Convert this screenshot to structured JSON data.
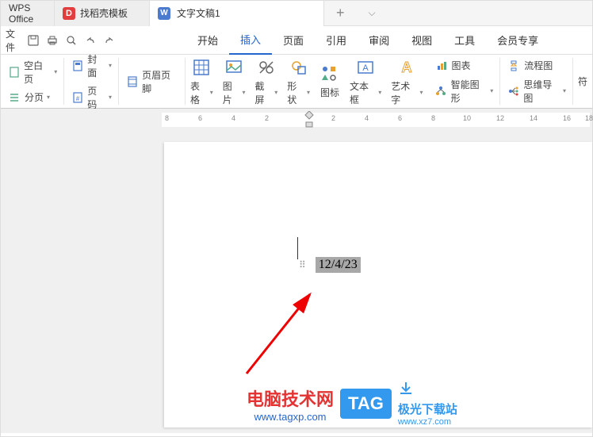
{
  "title_bar": {
    "app_name": "WPS Office",
    "template_tab": "找稻壳模板",
    "doc_tab": "文字文稿1",
    "new_tab": "+"
  },
  "menu": {
    "file": "文件",
    "start": "开始",
    "insert": "插入",
    "page": "页面",
    "reference": "引用",
    "review": "审阅",
    "view": "视图",
    "tools": "工具",
    "member": "会员专享"
  },
  "ribbon": {
    "cover": "封面",
    "page_num": "页码",
    "blank_page": "分页",
    "header_footer": "页眉页脚",
    "table": "表格",
    "picture": "图片",
    "screenshot": "截屏",
    "shape": "形状",
    "icon": "图标",
    "textbox": "文本框",
    "wordart": "艺术字",
    "chart": "图表",
    "smartart": "智能图形",
    "flowchart": "流程图",
    "mindmap": "思维导图",
    "symbol": "符",
    "blank_pg": "空白页"
  },
  "ruler_nums": [
    "8",
    "6",
    "4",
    "2",
    "2",
    "4",
    "6",
    "8",
    "10",
    "12",
    "14",
    "16",
    "18"
  ],
  "document": {
    "date_value": "12/4/23"
  },
  "watermark": {
    "site_title": "电脑技术网",
    "site_url": "www.tagxp.com",
    "tag_label": "TAG",
    "dl_title": "极光下载站",
    "dl_url": "www.xz7.com"
  }
}
